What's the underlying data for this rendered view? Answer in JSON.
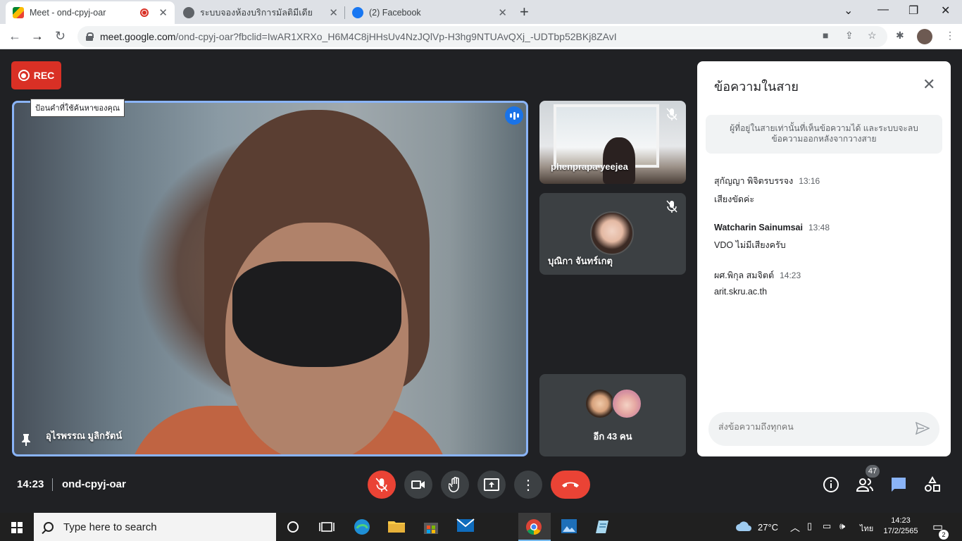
{
  "browser": {
    "tabs": [
      {
        "title": "Meet - ond-cpyj-oar",
        "active": true
      },
      {
        "title": "ระบบจองห้องบริการมัลติมีเดีย",
        "active": false
      },
      {
        "title": "(2) Facebook",
        "active": false
      }
    ],
    "url_host": "meet.google.com",
    "url_path": "/ond-cpyj-oar?fbclid=IwAR1XRXo_H6M4C8jHHsUv4NzJQlVp-H3hg9NTUAvQXj_-UDTbp52BKj8ZAvI"
  },
  "meet": {
    "rec_label": "REC",
    "tooltip": "ป้อนคำที่ใช้ค้นหาของคุณ",
    "main_participant": "อุไรพรรณ มูลิกรัตน์",
    "participants": [
      {
        "name": "phenprapa yeejea",
        "muted": true
      },
      {
        "name": "บุณิกา จันทร์เกตุ",
        "muted": true
      }
    ],
    "others_label": "อีก 43 คน",
    "meeting_time": "14:23",
    "meeting_code": "ond-cpyj-oar",
    "people_count": "47"
  },
  "chat": {
    "title": "ข้อความในสาย",
    "notice": "ผู้ที่อยู่ในสายเท่านั้นที่เห็นข้อความได้ และระบบจะลบข้อความออกหลังจากวางสาย",
    "messages": [
      {
        "sender": "สุกัญญา พิจิตรบรรจง",
        "time": "13:16",
        "text": "เสียงขัดค่ะ"
      },
      {
        "sender": "Watcharin Sainumsai",
        "time": "13:48",
        "text": "VDO ไม่มีเสียงครับ"
      },
      {
        "sender": "ผศ.พิกุล สมจิตต์",
        "time": "14:23",
        "text": "arit.skru.ac.th"
      }
    ],
    "input_placeholder": "ส่งข้อความถึงทุกคน"
  },
  "taskbar": {
    "search_placeholder": "Type here to search",
    "weather": "27°C",
    "language": "ไทย",
    "clock_time": "14:23",
    "clock_date": "17/2/2565",
    "notifications": "2"
  },
  "colors": {
    "meet_bg": "#202124",
    "rec_red": "#d93025",
    "speaking_blue": "#1a73e8",
    "end_call_red": "#ea4335",
    "active_border": "#8ab4f8"
  }
}
